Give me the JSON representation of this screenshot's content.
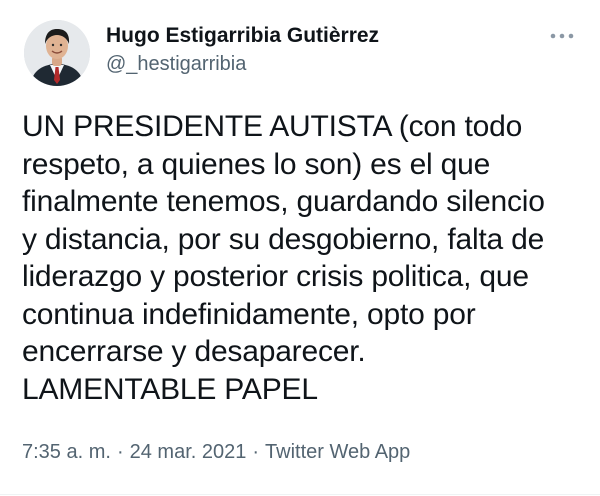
{
  "author": {
    "display_name": "Hugo Estigarribia Gutièrrez",
    "handle": "@_hestigarribia",
    "avatar_icon": "profile-photo"
  },
  "menu": {
    "icon": "more-horizontal-icon"
  },
  "tweet": {
    "text": "UN PRESIDENTE AUTISTA (con todo\nrespeto, a quienes lo son) es el que\nfinalmente tenemos, guardando silencio\ny distancia, por su desgobierno, falta de\nliderazgo y posterior crisis politica, que\ncontinua indefinidamente, opto por\nencerrarse y desaparecer.\nLAMENTABLE PAPEL"
  },
  "meta": {
    "time": "7:35 a. m.",
    "date": "24 mar. 2021",
    "source": "Twitter Web App",
    "separator": "·"
  },
  "colors": {
    "text": "#0f1419",
    "secondary": "#536471",
    "background": "#ffffff"
  }
}
